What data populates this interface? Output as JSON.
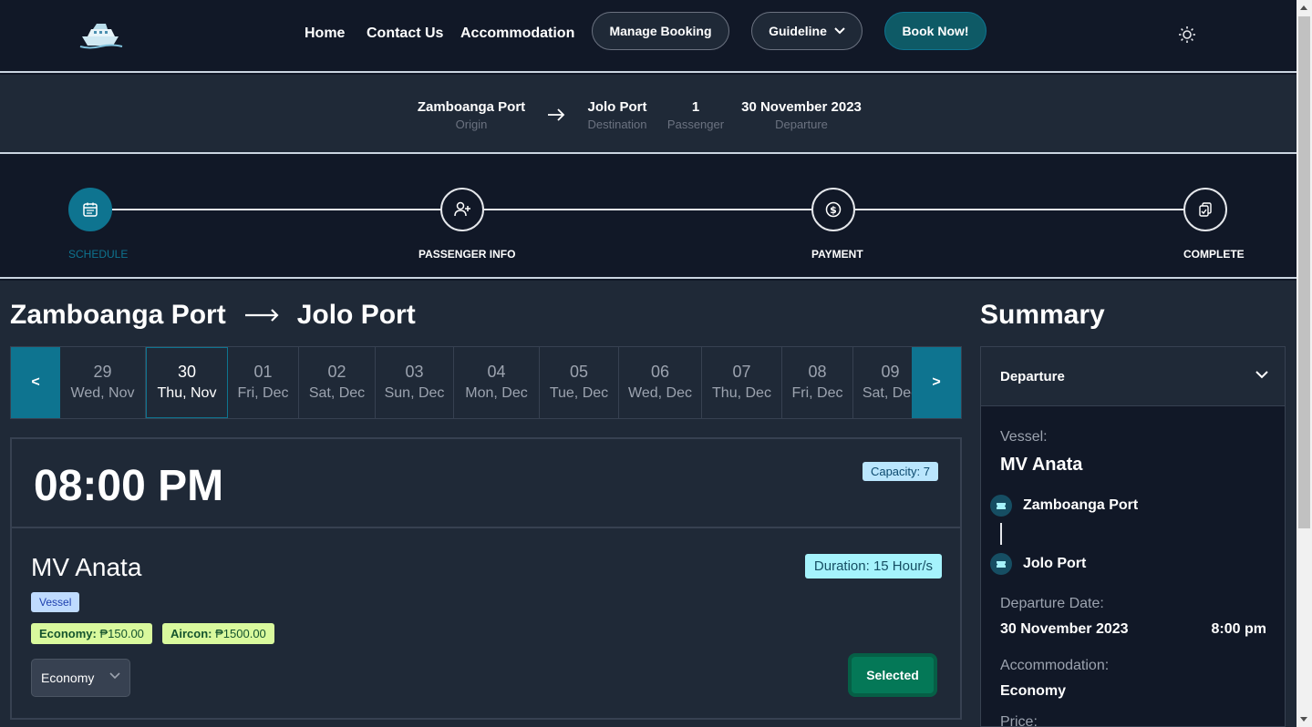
{
  "nav": {
    "home": "Home",
    "contact": "Contact Us",
    "accommodation": "Accommodation",
    "manage_booking": "Manage Booking",
    "guideline": "Guideline",
    "book_now": "Book Now!"
  },
  "route": {
    "origin": "Zamboanga Port",
    "origin_label": "Origin",
    "destination": "Jolo Port",
    "destination_label": "Destination",
    "passengers": "1",
    "passengers_label": "Passenger",
    "departure": "30 November 2023",
    "departure_label": "Departure"
  },
  "steps": [
    {
      "label": "SCHEDULE",
      "active": true,
      "icon": "calendar-icon"
    },
    {
      "label": "PASSENGER INFO",
      "active": false,
      "icon": "user-plus-icon"
    },
    {
      "label": "PAYMENT",
      "active": false,
      "icon": "dollar-icon"
    },
    {
      "label": "COMPLETE",
      "active": false,
      "icon": "clipboard-check-icon"
    }
  ],
  "main": {
    "from": "Zamboanga Port",
    "to": "Jolo Port"
  },
  "dates": {
    "prev": "<",
    "next": ">",
    "items": [
      {
        "num": "29",
        "day": "Wed, Nov"
      },
      {
        "num": "30",
        "day": "Thu, Nov"
      },
      {
        "num": "01",
        "day": "Fri, Dec"
      },
      {
        "num": "02",
        "day": "Sat, Dec"
      },
      {
        "num": "03",
        "day": "Sun, Dec"
      },
      {
        "num": "04",
        "day": "Mon, Dec"
      },
      {
        "num": "05",
        "day": "Tue, Dec"
      },
      {
        "num": "06",
        "day": "Wed, Dec"
      },
      {
        "num": "07",
        "day": "Thu, Dec"
      },
      {
        "num": "08",
        "day": "Fri, Dec"
      },
      {
        "num": "09",
        "day": "Sat, Dec"
      }
    ],
    "selected_index": 1
  },
  "trip": {
    "time": "08:00 PM",
    "capacity": "Capacity: 7",
    "vessel": "MV Anata",
    "duration": "Duration: 15 Hour/s",
    "vessel_tag": "Vessel",
    "economy_label": "Economy:",
    "economy_price": "₱150.00",
    "aircon_label": "Aircon:",
    "aircon_price": "₱1500.00",
    "accommodation_value": "Economy",
    "selected_label": "Selected"
  },
  "summary": {
    "title": "Summary",
    "section": "Departure",
    "vessel_label": "Vessel:",
    "vessel": "MV Anata",
    "from_port": "Zamboanga Port",
    "to_port": "Jolo Port",
    "departure_date_label": "Departure Date:",
    "departure_date": "30 November 2023",
    "departure_time": "8:00 pm",
    "accommodation_label": "Accommodation:",
    "accommodation": "Economy",
    "price_label": "Price:"
  },
  "colors": {
    "accent": "#0e7490",
    "background": "#111827",
    "panel": "#1f2937"
  }
}
